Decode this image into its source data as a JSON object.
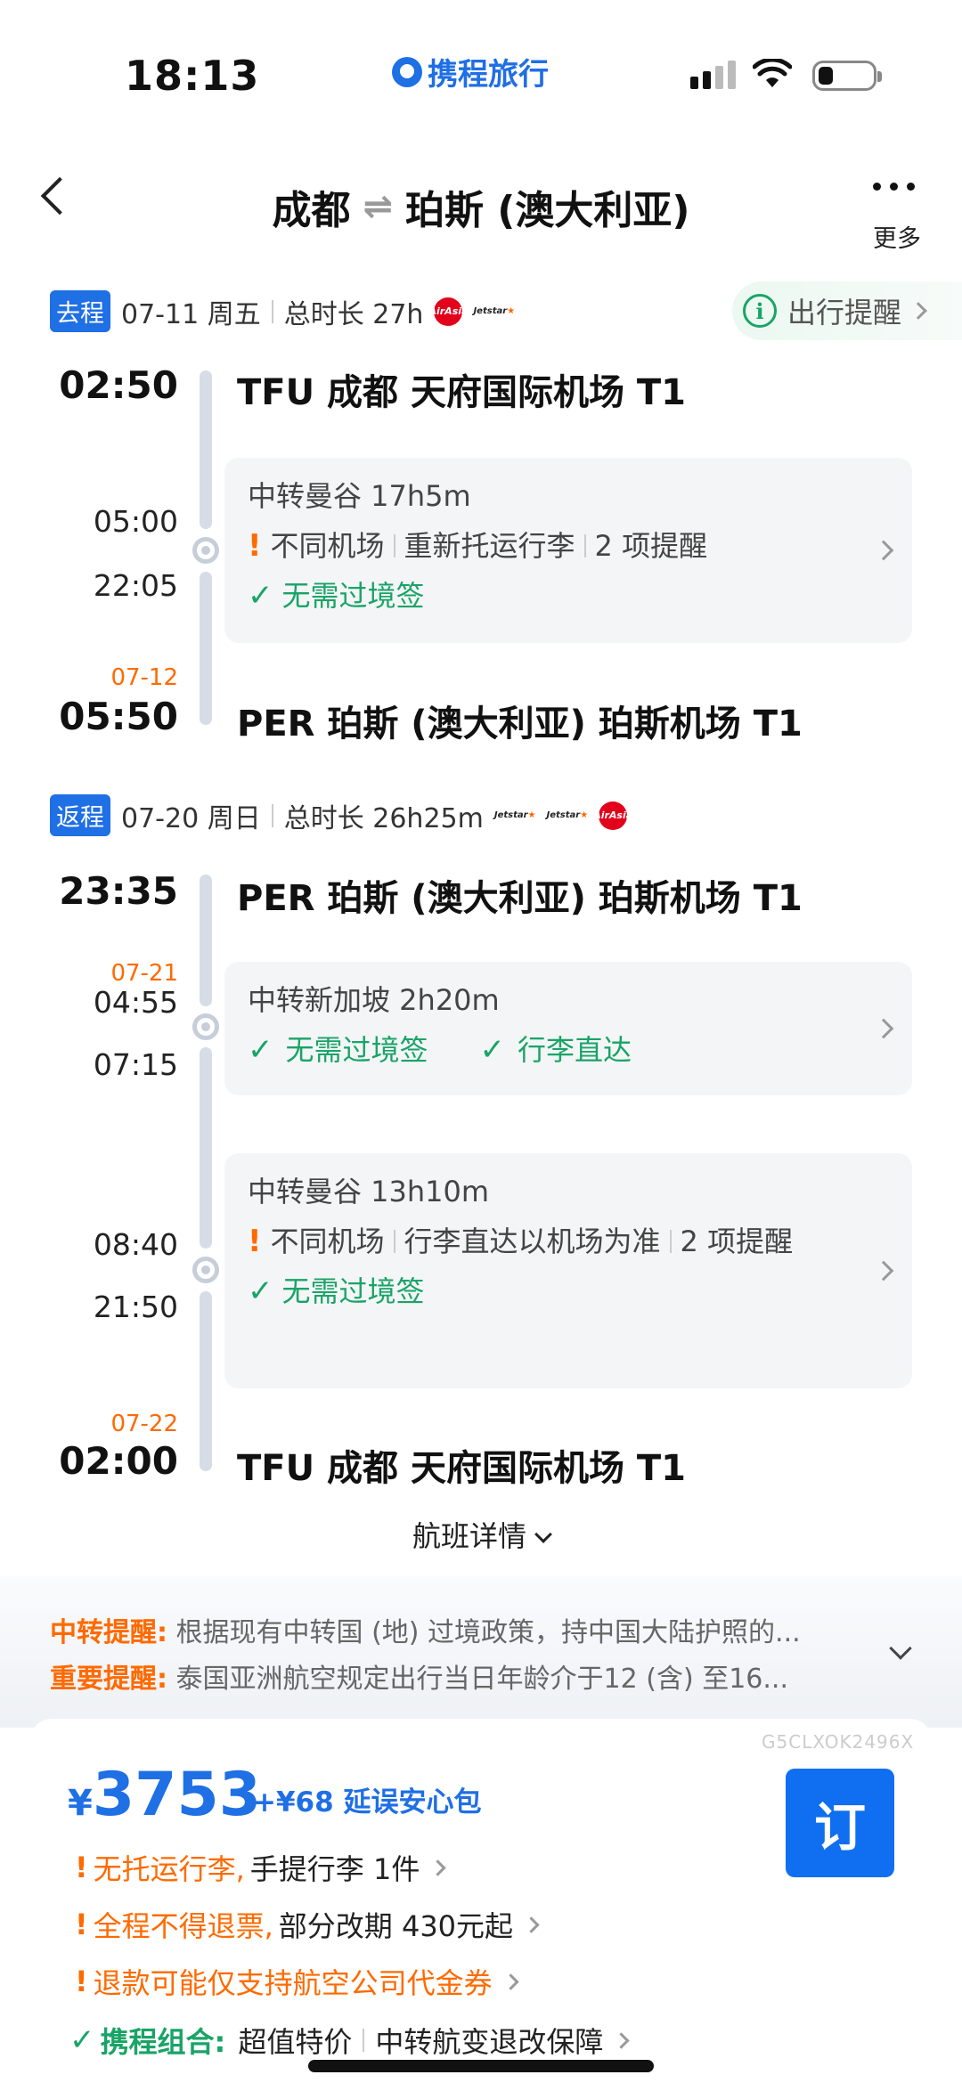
{
  "status": {
    "time": "18:13",
    "app_logo": "携程旅行"
  },
  "header": {
    "origin": "成都",
    "destination": "珀斯 (澳大利亚)",
    "more_label": "更多"
  },
  "outbound": {
    "tag": "去程",
    "date": "07-11 周五",
    "duration": "总时长 27h",
    "reminder_label": "出行提醒",
    "depart_time": "02:50",
    "depart_airport": "TFU  成都 天府国际机场 T1",
    "transfer": {
      "title": "中转曼谷 17h5m",
      "arrive_time": "05:00",
      "leave_time": "22:05",
      "warn_items": [
        "不同机场",
        "重新托运行李",
        "2 项提醒"
      ],
      "ok_items": [
        "无需过境签"
      ]
    },
    "arrive_date": "07-12",
    "arrive_time": "05:50",
    "arrive_airport": "PER  珀斯 (澳大利亚) 珀斯机场 T1"
  },
  "return": {
    "tag": "返程",
    "date": "07-20 周日",
    "duration": "总时长 26h25m",
    "depart_time": "23:35",
    "depart_airport": "PER  珀斯 (澳大利亚) 珀斯机场 T1",
    "transfer1": {
      "title": "中转新加坡 2h20m",
      "arrive_date": "07-21",
      "arrive_time": "04:55",
      "leave_time": "07:15",
      "ok_items": [
        "无需过境签",
        "行李直达"
      ]
    },
    "transfer2": {
      "title": "中转曼谷 13h10m",
      "arrive_time": "08:40",
      "leave_time": "21:50",
      "warn_items": [
        "不同机场",
        "行李直达以机场为准",
        "2 项提醒"
      ],
      "ok_items": [
        "无需过境签"
      ]
    },
    "arrive_date": "07-22",
    "arrive_time": "02:00",
    "arrive_airport": "TFU  成都 天府国际机场 T1"
  },
  "details_label": "航班详情",
  "notices": [
    {
      "label": "中转提醒:",
      "text": "根据现有中转国 (地) 过境政策，持中国大陆护照的..."
    },
    {
      "label": "重要提醒:",
      "text": "泰国亚洲航空规定出行当日年龄介于12 (含) 至16..."
    }
  ],
  "order": {
    "code": "G5CLXOK2496X",
    "currency": "¥",
    "price": "3753",
    "addon": "+¥68 延误安心包",
    "book_label": "订",
    "rules": [
      {
        "orange": "无托运行李,",
        "black": "手提行李 1件"
      },
      {
        "orange": "全程不得退票,",
        "black": "部分改期 430元起"
      },
      {
        "orange": "退款可能仅支持航空公司代金券",
        "black": ""
      }
    ],
    "combo_label": "携程组合:",
    "combo_items": [
      "超值特价",
      "中转航变退改保障"
    ]
  },
  "colors": {
    "brand_blue": "#1f6fe5",
    "warning_orange": "#ff6a00",
    "ok_green": "#19a467"
  },
  "icons": [
    "back-chevron-icon",
    "more-dots-icon",
    "info-circle-icon",
    "chevron-right-icon",
    "exclamation-icon",
    "checkmark-icon",
    "wifi-icon",
    "battery-icon",
    "signal-icon",
    "airasia-logo",
    "jetstar-logo"
  ]
}
